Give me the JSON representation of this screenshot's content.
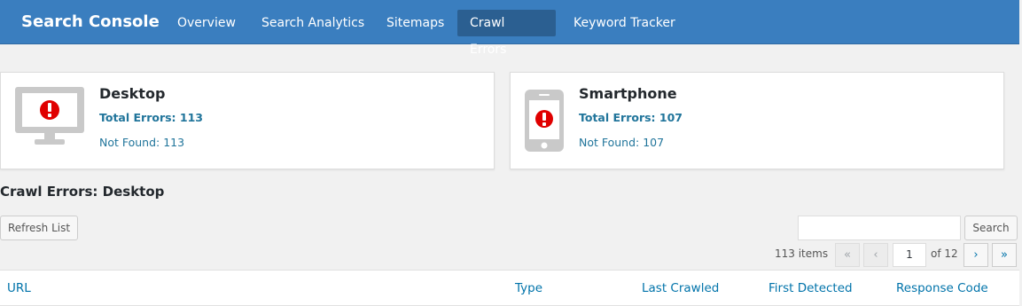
{
  "brand": "Search Console",
  "nav": [
    {
      "label": "Overview"
    },
    {
      "label": "Search Analytics"
    },
    {
      "label": "Sitemaps"
    },
    {
      "label": "Crawl Errors",
      "active": true
    },
    {
      "label": "Keyword Tracker"
    }
  ],
  "cards": {
    "desktop": {
      "title": "Desktop",
      "total": "Total Errors: 113",
      "not_found": "Not Found: 113",
      "icon": "desktop-error-icon"
    },
    "smartphone": {
      "title": "Smartphone",
      "total": "Total Errors: 107",
      "not_found": "Not Found: 107",
      "icon": "smartphone-error-icon"
    }
  },
  "section_title": "Crawl Errors: Desktop",
  "toolbar": {
    "refresh_label": "Refresh List",
    "search_placeholder": "",
    "search_label": "Search"
  },
  "pagination": {
    "items": "113 items",
    "first": "«",
    "prev": "‹",
    "current": "1",
    "of": "of 12",
    "next": "›",
    "last": "»"
  },
  "table": {
    "columns": [
      "URL",
      "Type",
      "Last Crawled",
      "First Detected",
      "Response Code"
    ]
  },
  "colors": {
    "topbar": "#3a7ebf",
    "active_tab": "#2b5f91",
    "link": "#0073aa",
    "error": "#e00000"
  }
}
